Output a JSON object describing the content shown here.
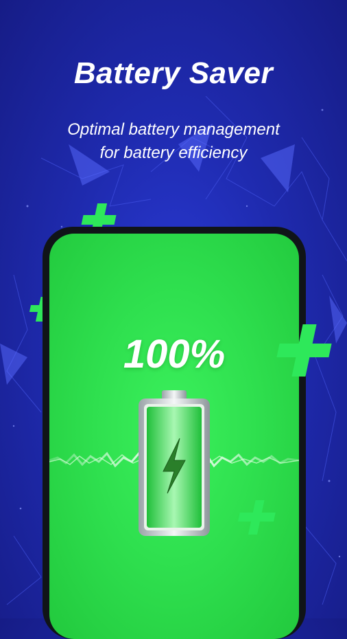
{
  "header": {
    "title": "Battery Saver",
    "subtitle_line1": "Optimal battery management",
    "subtitle_line2": "for battery efficiency"
  },
  "battery": {
    "percent_label": "100%",
    "level": 1.0
  },
  "icons": [
    "plus-icon",
    "battery-icon",
    "lightning-bolt-icon"
  ],
  "colors": {
    "background": "#1f2bb0",
    "screen_green": "#2fe04f",
    "accent_green": "#3ee660",
    "text": "#ffffff"
  }
}
